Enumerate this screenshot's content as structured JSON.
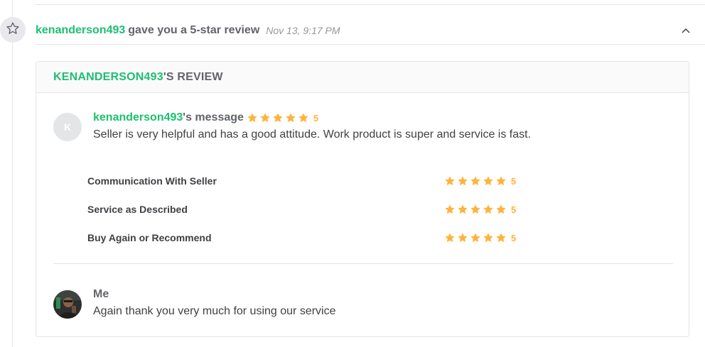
{
  "event": {
    "username": "kenanderson493",
    "action_text": "gave you a 5-star review",
    "timestamp": "Nov 13, 9:17 PM",
    "icon": "star-outline-icon",
    "collapse_icon": "chevron-up-icon"
  },
  "review": {
    "title_user": "KENANDERSON493",
    "title_suffix": "'S REVIEW",
    "message": {
      "avatar_letter": "K",
      "user": "kenanderson493",
      "suffix": "'s message",
      "rating": 5,
      "score": "5",
      "text": "Seller is very helpful and has a good attitude. Work product is super and service is fast."
    },
    "criteria": [
      {
        "label": "Communication With Seller",
        "rating": 5,
        "score": "5"
      },
      {
        "label": "Service as Described",
        "rating": 5,
        "score": "5"
      },
      {
        "label": "Buy Again or Recommend",
        "rating": 5,
        "score": "5"
      }
    ],
    "reply": {
      "name": "Me",
      "text": "Again thank you very much for using our service"
    }
  },
  "colors": {
    "accent_green": "#1dbf73",
    "star": "#ffb33e",
    "text_dark": "#404145",
    "text_muted": "#62646a",
    "border": "#e4e5e7"
  }
}
